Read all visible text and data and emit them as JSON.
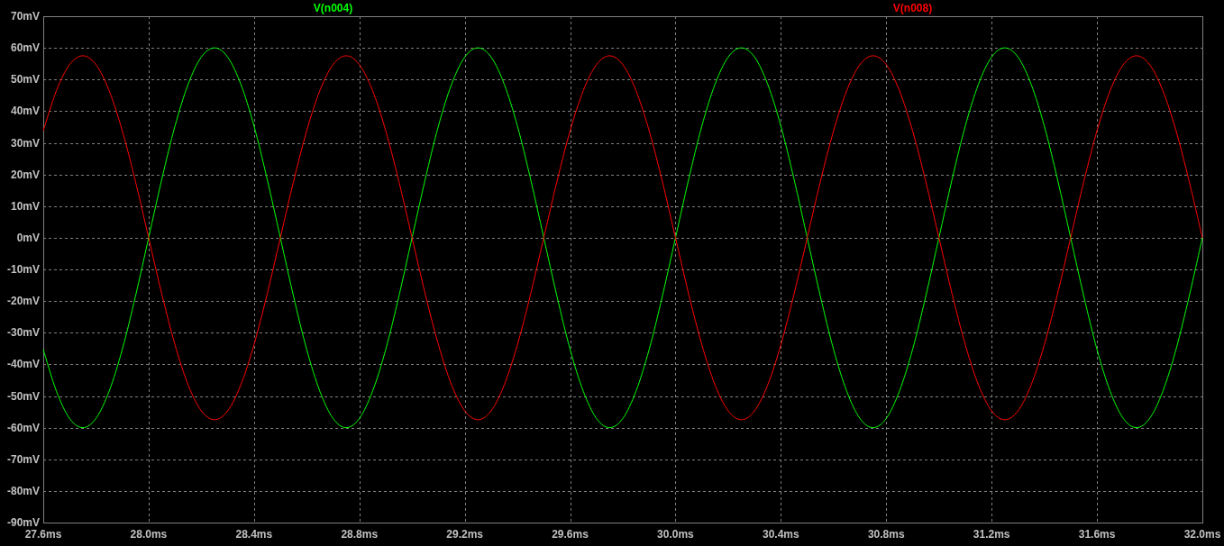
{
  "chart": {
    "chart_data": {
      "type": "line",
      "grid": true,
      "xlim": [
        27.6,
        32.0
      ],
      "ylim": [
        -90,
        70
      ],
      "xticks": [
        {
          "value": 27.6,
          "label": "27.6ms"
        },
        {
          "value": 28.0,
          "label": "28.0ms"
        },
        {
          "value": 28.4,
          "label": "28.4ms"
        },
        {
          "value": 28.8,
          "label": "28.8ms"
        },
        {
          "value": 29.2,
          "label": "29.2ms"
        },
        {
          "value": 29.6,
          "label": "29.6ms"
        },
        {
          "value": 30.0,
          "label": "30.0ms"
        },
        {
          "value": 30.4,
          "label": "30.4ms"
        },
        {
          "value": 30.8,
          "label": "30.8ms"
        },
        {
          "value": 31.2,
          "label": "31.2ms"
        },
        {
          "value": 31.6,
          "label": "31.6ms"
        },
        {
          "value": 32.0,
          "label": "32.0ms"
        }
      ],
      "yticks": [
        {
          "value": 70,
          "label": "70mV"
        },
        {
          "value": 60,
          "label": "60mV"
        },
        {
          "value": 50,
          "label": "50mV"
        },
        {
          "value": 40,
          "label": "40mV"
        },
        {
          "value": 30,
          "label": "30mV"
        },
        {
          "value": 20,
          "label": "20mV"
        },
        {
          "value": 10,
          "label": "10mV"
        },
        {
          "value": 0,
          "label": "0mV"
        },
        {
          "value": -10,
          "label": "-10mV"
        },
        {
          "value": -20,
          "label": "-20mV"
        },
        {
          "value": -30,
          "label": "-30mV"
        },
        {
          "value": -40,
          "label": "-40mV"
        },
        {
          "value": -50,
          "label": "-50mV"
        },
        {
          "value": -60,
          "label": "-60mV"
        },
        {
          "value": -70,
          "label": "-70mV"
        },
        {
          "value": -80,
          "label": "-80mV"
        },
        {
          "value": -90,
          "label": "-90mV"
        }
      ],
      "x": [
        27.6,
        27.65,
        27.7,
        27.75,
        27.8,
        27.85,
        27.9,
        27.95,
        28.0,
        28.05,
        28.1,
        28.15,
        28.2,
        28.25,
        28.3,
        28.35,
        28.4,
        28.45,
        28.5,
        28.55,
        28.6,
        28.65,
        28.7,
        28.75,
        28.8,
        28.85,
        28.9,
        28.95,
        29.0,
        29.05,
        29.1,
        29.15,
        29.2,
        29.25,
        29.3,
        29.35,
        29.4,
        29.45,
        29.5,
        29.55,
        29.6,
        29.65,
        29.7,
        29.75,
        29.8,
        29.85,
        29.9,
        29.95,
        30.0,
        30.05,
        30.1,
        30.15,
        30.2,
        30.25,
        30.3,
        30.35,
        30.4,
        30.45,
        30.5,
        30.55,
        30.6,
        30.65,
        30.7,
        30.75,
        30.8,
        30.85,
        30.9,
        30.95,
        31.0,
        31.05,
        31.1,
        31.15,
        31.2,
        31.25,
        31.3,
        31.35,
        31.4,
        31.45,
        31.5,
        31.55,
        31.6,
        31.65,
        31.7,
        31.75,
        31.8,
        31.85,
        31.9,
        31.95,
        32.0
      ],
      "series": [
        {
          "name": "V(n004)",
          "color": "#00ff00",
          "values": [
            -35.3,
            -48.5,
            -57.1,
            -60,
            -57.1,
            -48.5,
            -35.3,
            -18.5,
            0,
            18.5,
            35.3,
            48.5,
            57.1,
            60,
            57.1,
            48.5,
            35.3,
            18.5,
            0,
            -18.5,
            -35.3,
            -48.5,
            -57.1,
            -60,
            -57.1,
            -48.5,
            -35.3,
            -18.5,
            0,
            18.5,
            35.3,
            48.5,
            57.1,
            60,
            57.1,
            48.5,
            35.3,
            18.5,
            0,
            -18.5,
            -35.3,
            -48.5,
            -57.1,
            -60,
            -57.1,
            -48.5,
            -35.3,
            -18.5,
            0,
            18.5,
            35.3,
            48.5,
            57.1,
            60,
            57.1,
            48.5,
            35.3,
            18.5,
            0,
            -18.5,
            -35.3,
            -48.5,
            -57.1,
            -60,
            -57.1,
            -48.5,
            -35.3,
            -18.5,
            0,
            18.5,
            35.3,
            48.5,
            57.1,
            60,
            57.1,
            48.5,
            35.3,
            18.5,
            0,
            -18.5,
            -35.3,
            -48.5,
            -57.1,
            -60,
            -57.1,
            -48.5,
            -35.3,
            -18.5,
            0
          ]
        },
        {
          "name": "V(n008)",
          "color": "#ff0000",
          "values": [
            33.8,
            46.5,
            54.7,
            57.5,
            54.7,
            46.5,
            33.8,
            17.8,
            0,
            -17.8,
            -33.8,
            -46.5,
            -54.7,
            -57.5,
            -54.7,
            -46.5,
            -33.8,
            -17.8,
            0,
            17.8,
            33.8,
            46.5,
            54.7,
            57.5,
            54.7,
            46.5,
            33.8,
            17.8,
            0,
            -17.8,
            -33.8,
            -46.5,
            -54.7,
            -57.5,
            -54.7,
            -46.5,
            -33.8,
            -17.8,
            0,
            17.8,
            33.8,
            46.5,
            54.7,
            57.5,
            54.7,
            46.5,
            33.8,
            17.8,
            0,
            -17.8,
            -33.8,
            -46.5,
            -54.7,
            -57.5,
            -54.7,
            -46.5,
            -33.8,
            -17.8,
            0,
            17.8,
            33.8,
            46.5,
            54.7,
            57.5,
            54.7,
            46.5,
            33.8,
            17.8,
            0,
            -17.8,
            -33.8,
            -46.5,
            -54.7,
            -57.5,
            -54.7,
            -46.5,
            -33.8,
            -17.8,
            0,
            17.8,
            33.8,
            46.5,
            54.7,
            57.5,
            54.7,
            46.5,
            33.8,
            17.8,
            0
          ]
        }
      ]
    }
  }
}
